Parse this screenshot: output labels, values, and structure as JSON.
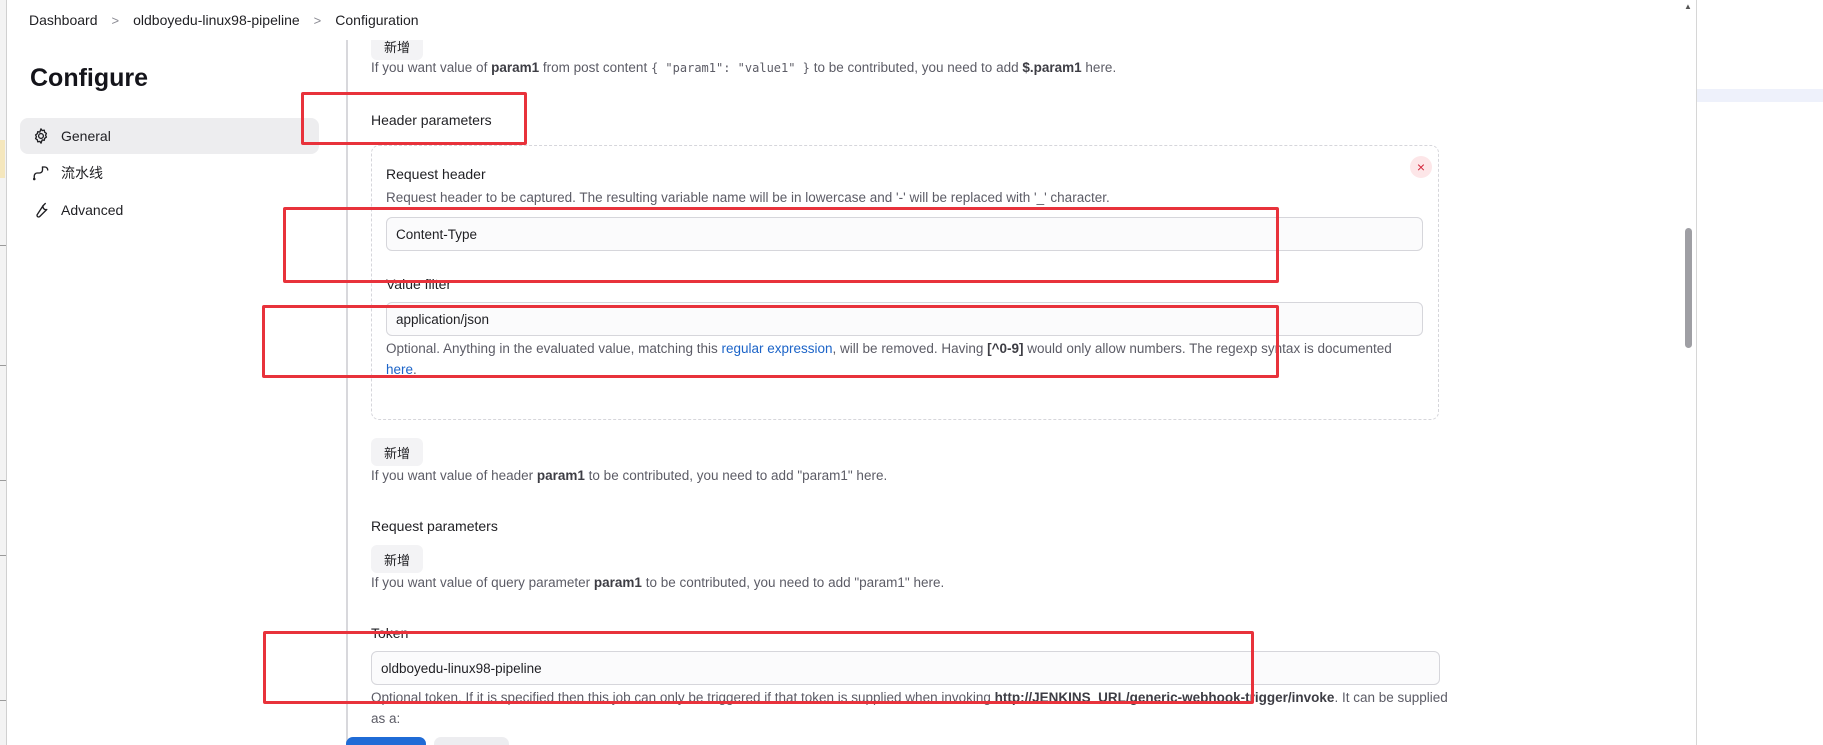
{
  "breadcrumb": {
    "items": [
      "Dashboard",
      "oldboyedu-linux98-pipeline",
      "Configuration"
    ],
    "separator": ">"
  },
  "sidebar": {
    "title": "Configure",
    "items": [
      {
        "label": "General",
        "icon": "gear-icon",
        "active": true
      },
      {
        "label": "流水线",
        "icon": "pipeline-icon",
        "active": false
      },
      {
        "label": "Advanced",
        "icon": "wrench-icon",
        "active": false
      }
    ]
  },
  "post_content": {
    "add_label": "新增",
    "help_prefix": "If you want value of",
    "help_param": "param1",
    "help_mid": "from post content",
    "help_code": "{ \"param1\": \"value1\" }",
    "help_mid2": "to be contributed, you need to add",
    "help_expr": "$.param1",
    "help_suffix": "here."
  },
  "header_params": {
    "title": "Header parameters",
    "remove_label": "×",
    "request_header_label": "Request header",
    "request_header_help": "Request header to be captured. The resulting variable name will be in lowercase and '-' will be replaced with '_' character.",
    "request_header_value": "Content-Type",
    "value_filter_label": "Value filter",
    "value_filter_value": "application/json",
    "filter_help_1": "Optional. Anything in the evaluated value, matching this",
    "filter_help_link": "regular expression",
    "filter_help_2": ", will be removed. Having",
    "filter_help_code": "[^0-9]",
    "filter_help_3": "would only allow numbers. The regexp syntax is documented",
    "filter_help_here": "here",
    "filter_help_dot": ".",
    "add_label": "新增",
    "help_prefix": "If you want value of header",
    "help_param": "param1",
    "help_suffix": "to be contributed, you need to add \"param1\" here."
  },
  "request_params": {
    "title": "Request parameters",
    "add_label": "新增",
    "help_prefix": "If you want value of query parameter",
    "help_param": "param1",
    "help_suffix": "to be contributed, you need to add \"param1\" here."
  },
  "token": {
    "label": "Token",
    "value": "oldboyedu-linux98-pipeline",
    "help_1": "Optional token. If it is specified then this job can only be triggered if that token is supplied when invoking",
    "help_url": "http://JENKINS_URL/generic-webhook-trigger/invoke",
    "help_2": ". It can be",
    "help_3": "supplied as a:"
  },
  "colors": {
    "annotation_red": "#e8323b",
    "link_blue": "#1c64c8",
    "primary_button": "#1f6bd6"
  }
}
